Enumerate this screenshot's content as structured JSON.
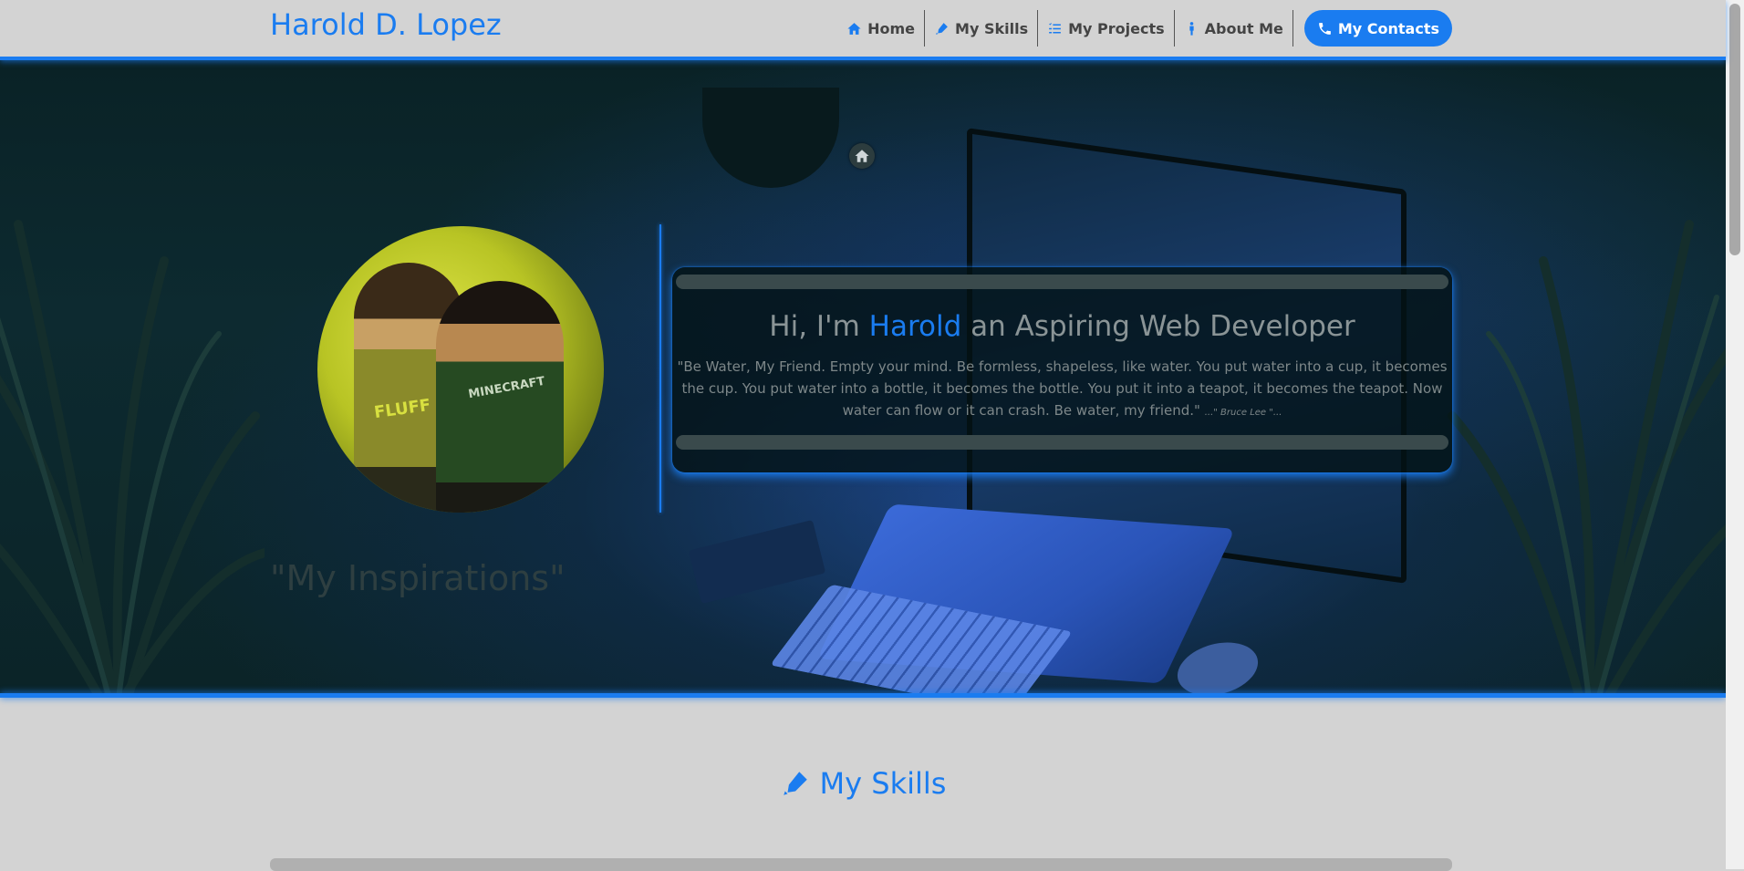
{
  "brand": "Harold D. Lopez",
  "nav": {
    "items": [
      {
        "label": "Home",
        "icon": "home-icon"
      },
      {
        "label": "My Skills",
        "icon": "pen-icon"
      },
      {
        "label": "My Projects",
        "icon": "list-check-icon"
      },
      {
        "label": "About Me",
        "icon": "person-icon"
      }
    ],
    "contact": {
      "label": "My Contacts",
      "icon": "phone-icon"
    }
  },
  "hero": {
    "title_prefix": "Hi, I'm ",
    "title_name": "Harold",
    "title_suffix": " an Aspiring Web Developer",
    "quote": "\"Be Water, My Friend. Empty your mind. Be formless, shapeless, like water. You put water into a cup, it becomes the cup. You put water into a bottle, it becomes the bottle. You put it into a teapot, it becomes the teapot. Now water can flow or it can crash. Be water, my friend.\" ",
    "quote_author": "...\" Bruce Lee \"...",
    "inspirations": "\"My Inspirations\"",
    "shirt_text_1": "FLUFF",
    "shirt_text_2": "MINECRAFT"
  },
  "skills_section": {
    "title": "My Skills"
  },
  "colors": {
    "accent": "#1a7cf0",
    "background": "#d3d3d3"
  }
}
